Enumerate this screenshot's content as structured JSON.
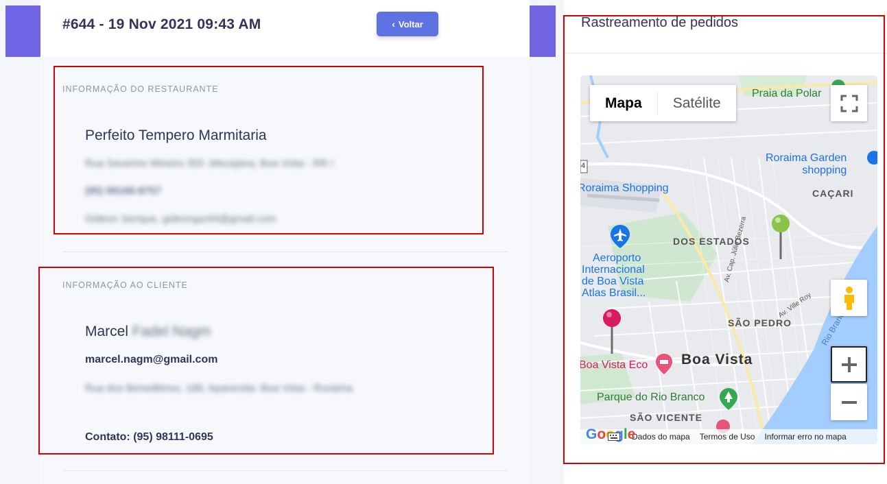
{
  "order": {
    "title": "#644 - 19 Nov 2021 09:43 AM",
    "back_label": "Voltar"
  },
  "restaurant": {
    "section_title": "INFORMAÇÃO DO RESTAURANTE",
    "name": "Perfeito Tempero Marmitaria",
    "address": "Rua Severino Mineiro 355 ,Mecejana, Boa Vista - RR /",
    "phone": "(95) 99166-8757",
    "email": "Gideon Serique, gideongsr94@gmail.com"
  },
  "client": {
    "section_title": "INFORMAÇÃO AO CLIENTE",
    "first_name": "Marcel",
    "last_name": "Fadel Nagm",
    "email": "marcel.nagm@gmail.com",
    "address": "Rua dos Beneditinos, 188, Aparecida- Boa Vista - Roraima",
    "contact": "Contato: (95) 98111-0695"
  },
  "tracking": {
    "title": "Rastreamento de pedidos",
    "map_types": [
      "Mapa",
      "Satélite"
    ],
    "map_labels": {
      "praia": "Praia da Polar",
      "garden": "Roraima Garden shopping",
      "garden_1": "Roraima Garden",
      "garden_2": "shopping",
      "cacari": "CAÇARI",
      "roraima_shopping": "Roraima Shopping",
      "dos_estados": "DOS ESTADOS",
      "aeroporto_1": "Aeroporto",
      "aeroporto_2": "Internacional",
      "aeroporto_3": "de Boa Vista",
      "aeroporto_4": "Atlas Brasil...",
      "sao_pedro": "SÃO PEDRO",
      "boa_vista": "Boa Vista",
      "boa_vista_eco": "Boa Vista Eco",
      "parque": "Parque do Rio Branco",
      "sao_vicente": "SÃO VICENTE",
      "av_julio": "Av. Cap. Júlio Bezerra",
      "av_ville": "Av. Ville Roy",
      "rio_branco": "Rio Branco",
      "route_badge": "4"
    },
    "attribution": {
      "google": "Google",
      "data": "Dados do mapa",
      "terms": "Termos de Uso",
      "report": "Informar erro no mapa"
    },
    "colors": {
      "river": "#a3ccff",
      "park": "#c8e6c9",
      "pin_green": "#8bc34a",
      "pin_pink": "#d81b60"
    }
  }
}
